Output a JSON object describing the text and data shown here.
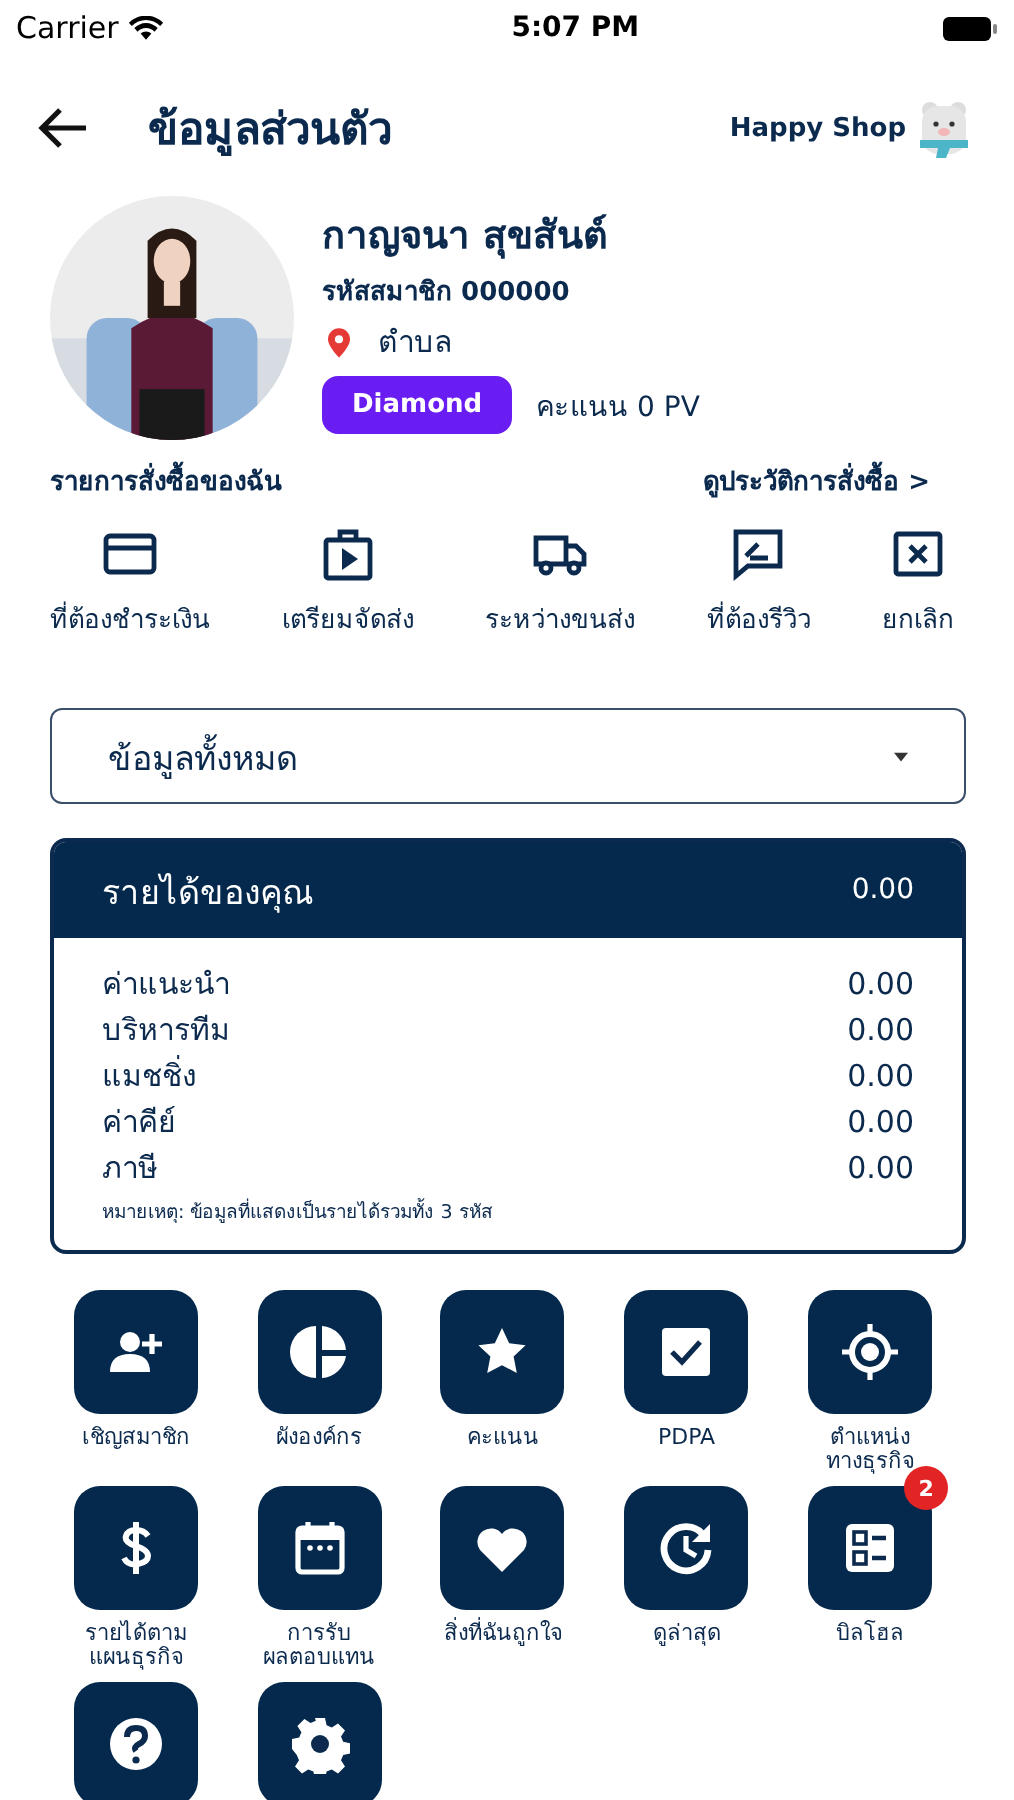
{
  "status_bar": {
    "carrier": "Carrier",
    "time": "5:07 PM"
  },
  "header": {
    "title": "ข้อมูลส่วนตัว",
    "brand": "Happy Shop"
  },
  "profile": {
    "name": "กาญจนา สุขสันต์",
    "member_code": "รหัสสมาชิก 000000",
    "location": "ตำบล",
    "rank": "Diamond",
    "points": "คะแนน 0 PV"
  },
  "orders": {
    "title": "รายการสั่งซื้อของฉัน",
    "history_link": "ดูประวัติการสั่งซื้อ >",
    "items": [
      {
        "kind": "card",
        "label": "ที่ต้องชำระเงิน"
      },
      {
        "kind": "package",
        "label": "เตรียมจัดส่ง"
      },
      {
        "kind": "truck",
        "label": "ระหว่างขนส่ง"
      },
      {
        "kind": "review",
        "label": "ที่ต้องรีวิว"
      },
      {
        "kind": "cancel",
        "label": "ยกเลิก"
      }
    ]
  },
  "dropdown": {
    "value": "ข้อมูลทั้งหมด"
  },
  "income": {
    "title": "รายได้ของคุณ",
    "total": "0.00",
    "rows": [
      {
        "label": "ค่าแนะนำ",
        "value": "0.00"
      },
      {
        "label": "บริหารทีม",
        "value": "0.00"
      },
      {
        "label": "แมชชิ่ง",
        "value": "0.00"
      },
      {
        "label": "ค่าคีย์",
        "value": "0.00"
      },
      {
        "label": "ภาษี",
        "value": "0.00"
      }
    ],
    "note": "หมายเหตุ: ข้อมูลที่แสดงเป็นรายได้รวมทั้ง 3 รหัส"
  },
  "menu": [
    {
      "kind": "add-user",
      "label": "เชิญสมาชิก"
    },
    {
      "kind": "pie",
      "label": "ผังองค์กร"
    },
    {
      "kind": "star",
      "label": "คะแนน"
    },
    {
      "kind": "checkbox",
      "label": "PDPA"
    },
    {
      "kind": "target",
      "label": "ตำแหน่ง\nทางธุรกิจ"
    },
    {
      "kind": "dollar",
      "label": "รายได้ตาม\nแผนธุรกิจ"
    },
    {
      "kind": "calendar",
      "label": "การรับ\nผลตอบแทน"
    },
    {
      "kind": "heart",
      "label": "สิ่งที่ฉันถูกใจ"
    },
    {
      "kind": "history",
      "label": "ดูล่าสุด"
    },
    {
      "kind": "list",
      "label": "บิลโฮล",
      "badge": "2"
    },
    {
      "kind": "help"
    },
    {
      "kind": "gear"
    }
  ]
}
